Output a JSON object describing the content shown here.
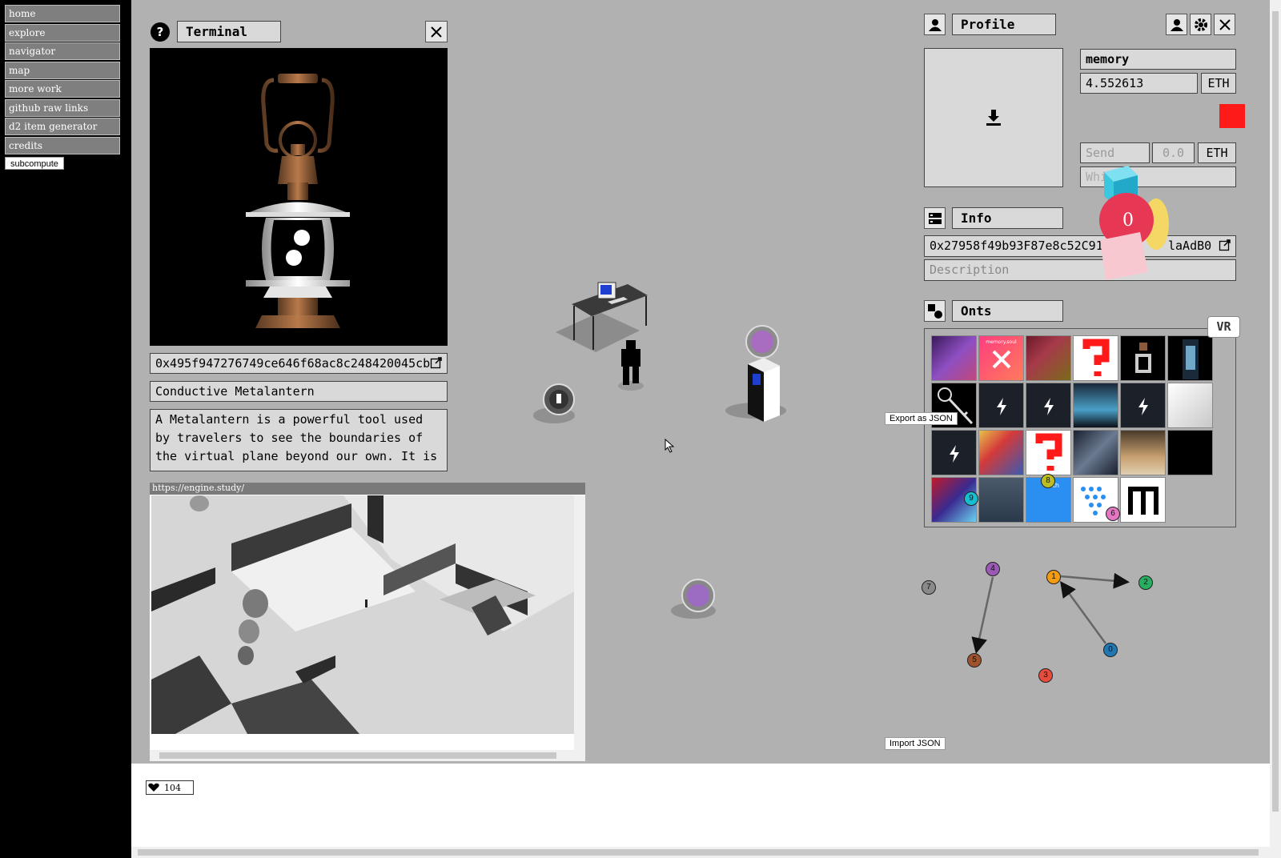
{
  "sidebar": {
    "items": [
      {
        "label": "home"
      },
      {
        "label": "explore"
      },
      {
        "label": "navigator"
      },
      {
        "label": "map"
      },
      {
        "label": "more work"
      },
      {
        "label": "github raw links"
      },
      {
        "label": "d2 item generator"
      },
      {
        "label": "credits"
      }
    ],
    "subcompute_label": "subcompute"
  },
  "terminal": {
    "title": "Terminal",
    "address": "0x495f947276749ce646f68ac8c248420045cb",
    "item_name": "Conductive Metalantern",
    "description": "A Metalantern is a powerful tool used by travelers to see the boundaries of the virtual plane beyond our own. It is"
  },
  "browser_preview": {
    "url": "https://engine.study/"
  },
  "likes": {
    "count": "104"
  },
  "profile": {
    "title": "Profile",
    "name": "memory",
    "balance": "4.552613",
    "currency": "ETH",
    "send_label": "Send",
    "send_amount": "0.0",
    "send_currency": "ETH",
    "whisper_placeholder": "Whi"
  },
  "info": {
    "title": "Info",
    "address": "0x27958f49b93F87e8c52C91",
    "address_tail": "laAdB0",
    "description_placeholder": "Description"
  },
  "onts": {
    "title": "Onts",
    "thumb_text_memory": "memory.soul",
    "thumb_text_eth": "eth",
    "badges": [
      "9",
      "8",
      "6"
    ]
  },
  "vr_label": "VR",
  "counter_ball_label": "0",
  "export_json_label": "Export as JSON",
  "import_json_label": "Import JSON",
  "graph_nodes": [
    {
      "label": "7",
      "color": "#8a8a8a"
    },
    {
      "label": "4",
      "color": "#9b59b6"
    },
    {
      "label": "1",
      "color": "#f39c12"
    },
    {
      "label": "2",
      "color": "#27ae60"
    },
    {
      "label": "5",
      "color": "#a0522d"
    },
    {
      "label": "0",
      "color": "#1f78b4"
    },
    {
      "label": "3",
      "color": "#e74c3c"
    }
  ],
  "colors": {
    "scene_bg": "#b1b1b1",
    "sidebar_bg": "#000000",
    "red_square": "#ff1a1a"
  }
}
